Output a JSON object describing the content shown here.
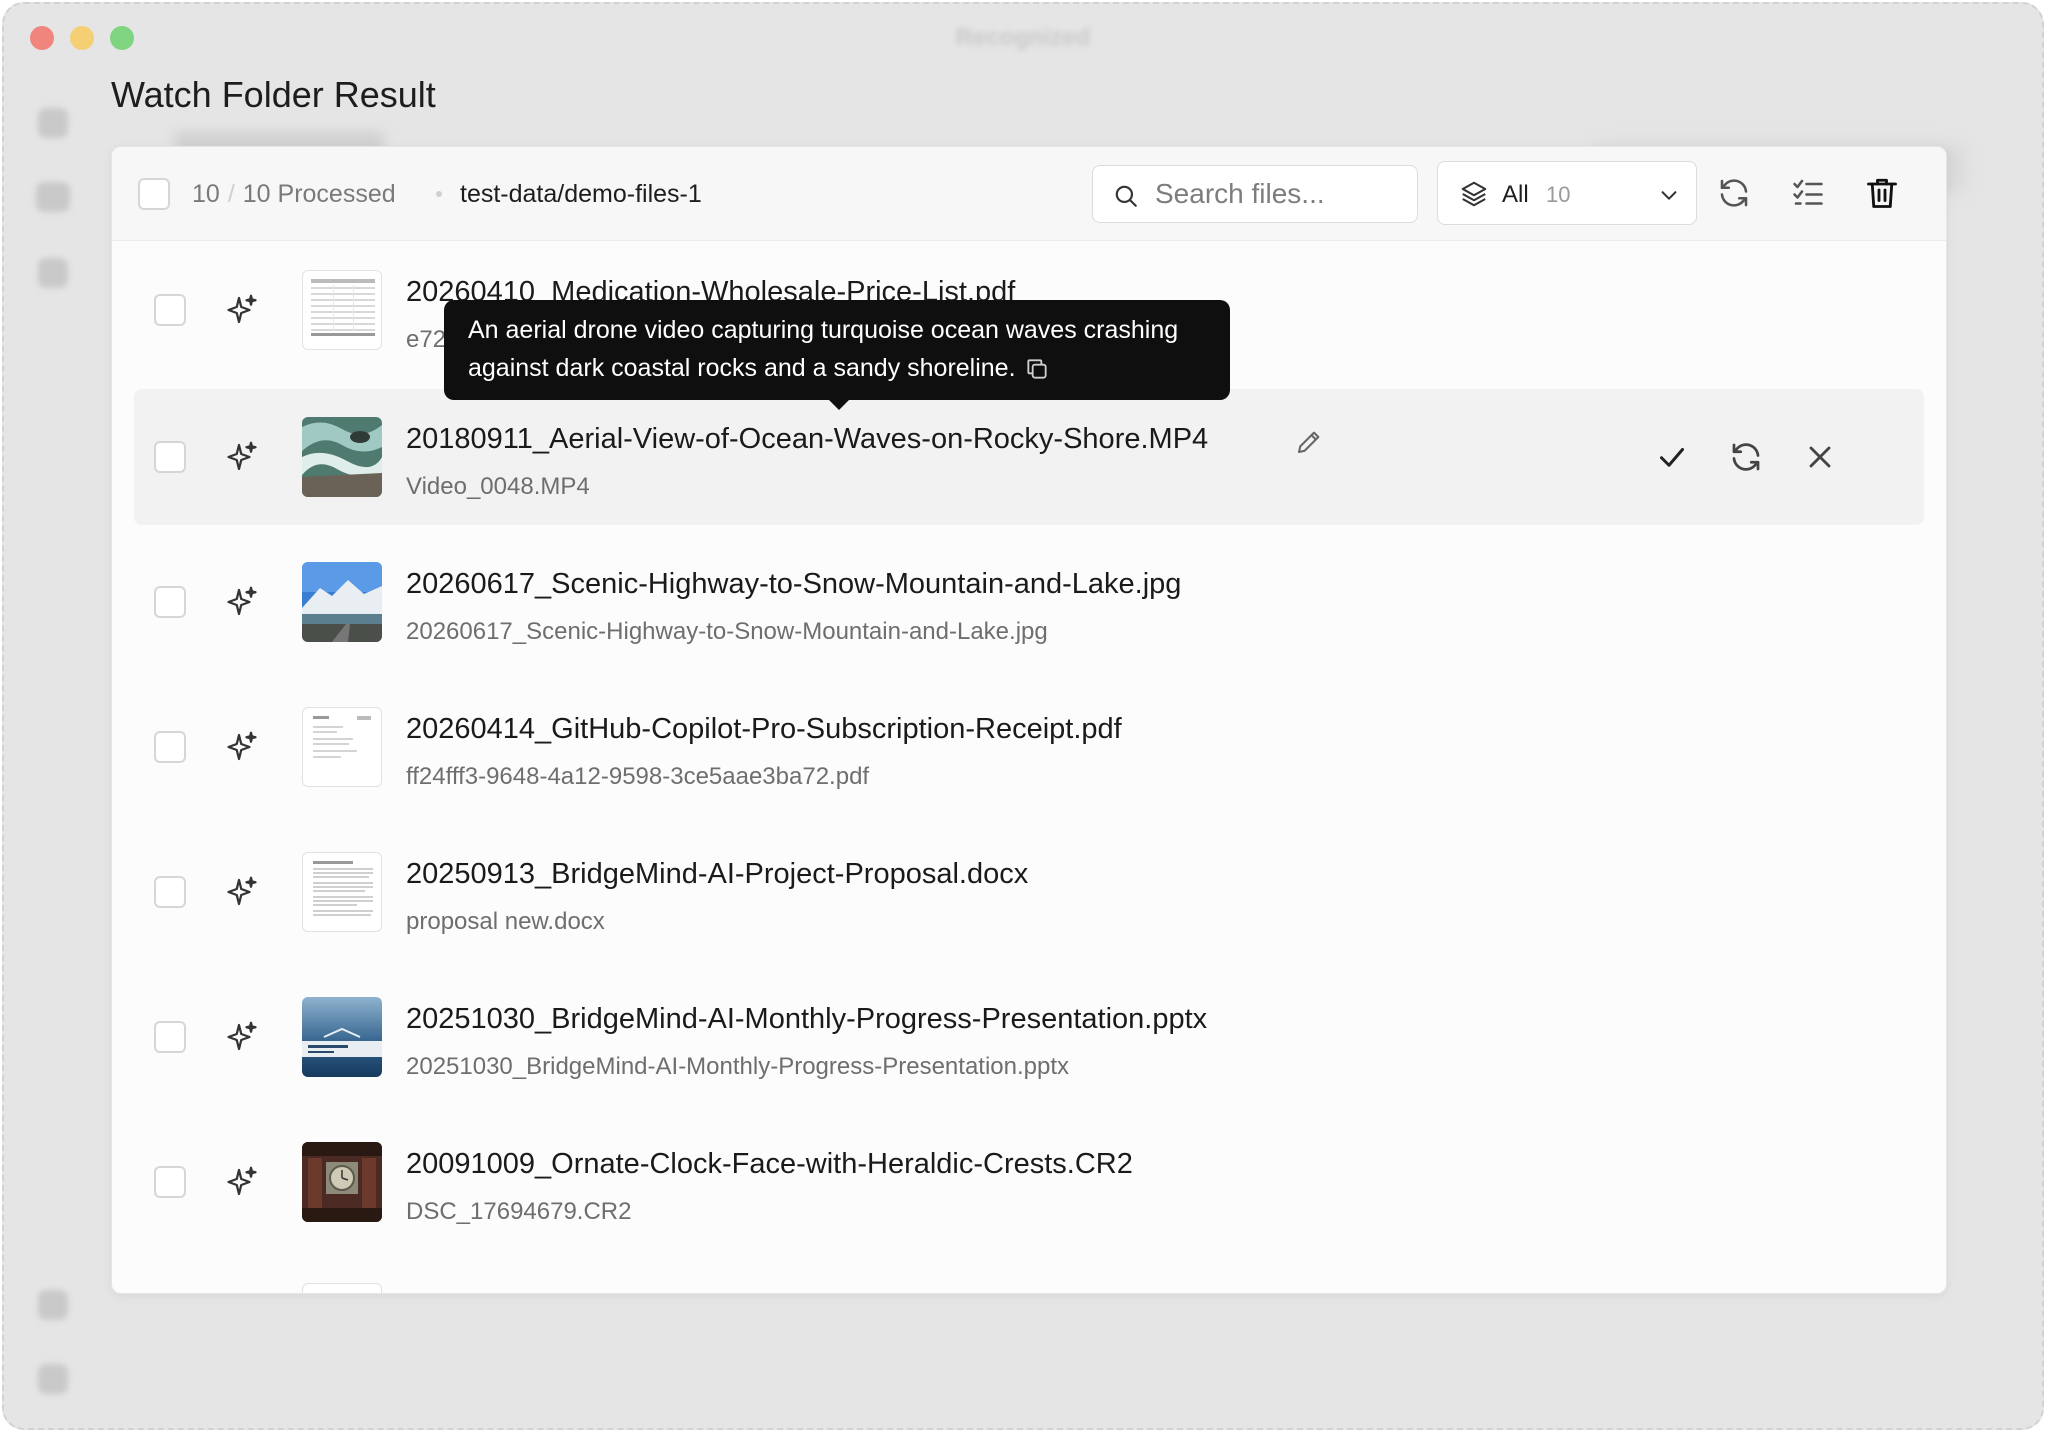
{
  "window": {
    "title": "Recognized"
  },
  "page": {
    "title": "Watch Folder Result"
  },
  "toolbar": {
    "processed_count": "10",
    "total_label": "10 Processed",
    "path": "test-data/demo-files-1",
    "search_placeholder": "Search files...",
    "filter_label": "All",
    "filter_count": "10"
  },
  "tooltip": {
    "text": "An aerial drone video capturing turquoise ocean waves crashing against dark coastal rocks and a sandy shoreline."
  },
  "files": [
    {
      "name": "20260410_Medication-Wholesale-Price-List.pdf",
      "original": "e72",
      "thumb": "doc-table-thumbnail"
    },
    {
      "name": "20180911_Aerial-View-of-Ocean-Waves-on-Rocky-Shore.MP4",
      "original": "Video_0048.MP4",
      "thumb": "ocean-thumbnail"
    },
    {
      "name": "20260617_Scenic-Highway-to-Snow-Mountain-and-Lake.jpg",
      "original": "20260617_Scenic-Highway-to-Snow-Mountain-and-Lake.jpg",
      "thumb": "mountain-thumbnail"
    },
    {
      "name": "20260414_GitHub-Copilot-Pro-Subscription-Receipt.pdf",
      "original": "ff24fff3-9648-4a12-9598-3ce5aae3ba72.pdf",
      "thumb": "receipt-thumbnail"
    },
    {
      "name": "20250913_BridgeMind-AI-Project-Proposal.docx",
      "original": "proposal new.docx",
      "thumb": "doc-text-thumbnail"
    },
    {
      "name": "20251030_BridgeMind-AI-Monthly-Progress-Presentation.pptx",
      "original": "20251030_BridgeMind-AI-Monthly-Progress-Presentation.pptx",
      "thumb": "slide-thumbnail"
    },
    {
      "name": "20091009_Ornate-Clock-Face-with-Heraldic-Crests.CR2",
      "original": "DSC_17694679.CR2",
      "thumb": "clock-thumbnail"
    }
  ],
  "colors": {
    "accent": "#1d1d1d",
    "muted": "#6e6e6e",
    "tooltip_bg": "#0f0f0f",
    "row_active": "#f2f2f2"
  }
}
